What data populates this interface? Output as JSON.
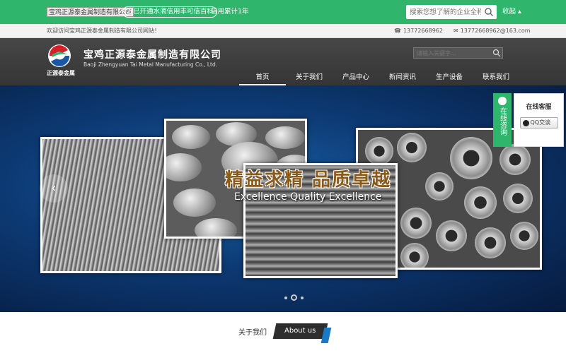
{
  "topbar": {
    "company_chip": "宝鸡正源泰金属制造有限公司",
    "cert": "已开通水滴信用丰可信百科",
    "years": "信用累计1年",
    "search_placeholder": "搜索您想了解的企业全称",
    "collapse": "收起 ▴"
  },
  "welcome": {
    "message": "欢迎访问宝鸡正源泰金属制造有限公司网站！",
    "phone": "13772668962",
    "email": "13772668962@163.com"
  },
  "header": {
    "logo_text": "正源泰金属",
    "company_name": "宝鸡正源泰金属制造有限公司",
    "company_en": "Baoji Zhengyuan Tai Metal Manufacturing Co., Ltd.",
    "search_placeholder": "请输入关键字...",
    "nav": [
      "首页",
      "关于我们",
      "产品中心",
      "新闻资讯",
      "生产设备",
      "联系我们"
    ],
    "active_nav": "首页"
  },
  "banner": {
    "title_cn": "精益求精  品质卓越",
    "title_en": "Excellence Quality Excellence",
    "prev_icon": "‹",
    "slide_count": 3,
    "active_slide": 2
  },
  "service": {
    "tab_label": "在线咨询",
    "title": "在线客服",
    "qq_label": "QQ交谈"
  },
  "about": {
    "title_cn": "关于我们",
    "title_en": "About us"
  },
  "colors": {
    "brand_green": "#30b66c",
    "header_dark": "#3c3c3c",
    "accent_blue": "#1a7ac6"
  }
}
